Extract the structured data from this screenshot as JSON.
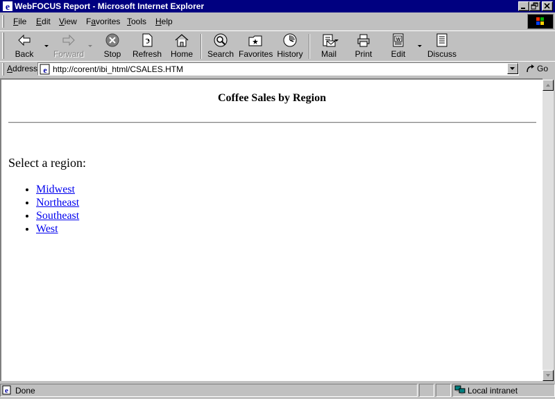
{
  "window": {
    "title": "WebFOCUS Report - Microsoft Internet Explorer"
  },
  "menu": [
    {
      "key": "F",
      "rest": "ile"
    },
    {
      "key": "E",
      "rest": "dit"
    },
    {
      "key": "V",
      "rest": "iew"
    },
    {
      "pre": "F",
      "key": "a",
      "rest": "vorites"
    },
    {
      "key": "T",
      "rest": "ools"
    },
    {
      "key": "H",
      "rest": "elp"
    }
  ],
  "toolbar": {
    "back": "Back",
    "forward": "Forward",
    "stop": "Stop",
    "refresh": "Refresh",
    "home": "Home",
    "search": "Search",
    "favorites": "Favorites",
    "history": "History",
    "mail": "Mail",
    "print": "Print",
    "edit": "Edit",
    "discuss": "Discuss"
  },
  "address": {
    "label_key": "A",
    "label_rest": "ddress",
    "url": "http://corent/ibi_html/CSALES.HTM",
    "go": "Go"
  },
  "page": {
    "title": "Coffee Sales by Region",
    "prompt": "Select a region:",
    "regions": [
      "Midwest",
      "Northeast",
      "Southeast",
      "West"
    ]
  },
  "status": {
    "text": "Done",
    "zone": "Local intranet"
  },
  "colors": {
    "titlebar": "#000080",
    "link": "#0000ee",
    "chrome": "#c0c0c0"
  }
}
